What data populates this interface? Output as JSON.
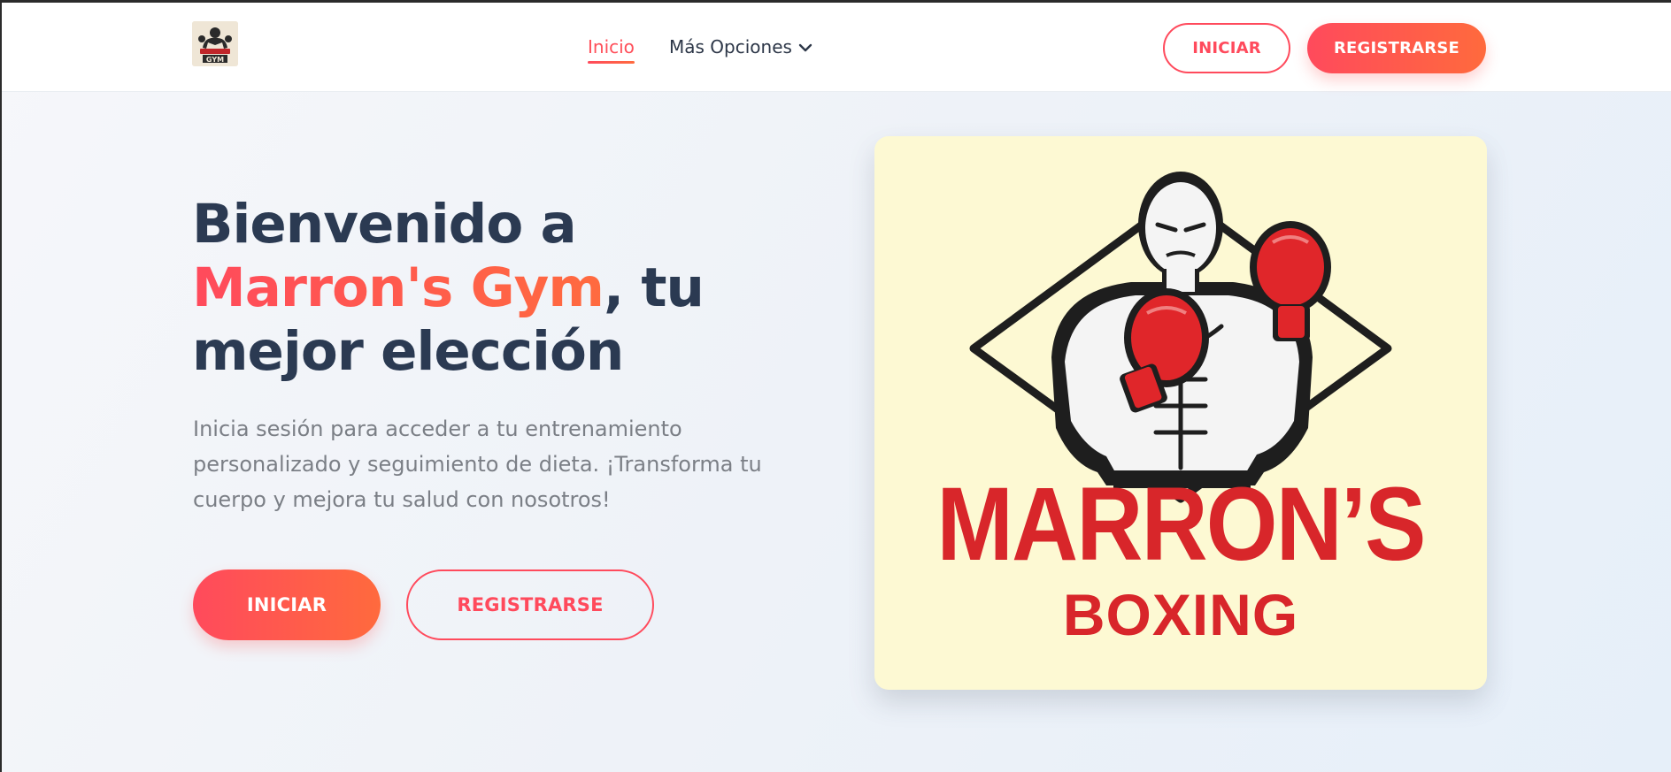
{
  "header": {
    "logo_alt": "Marron's Gym logo",
    "nav": {
      "inicio_label": "Inicio",
      "more_label": "Más Opciones"
    },
    "iniciar_label": "INICIAR",
    "registrarse_label": "REGISTRARSE"
  },
  "hero": {
    "title_part1": "Bienvenido a ",
    "title_brand": "Marron's Gym",
    "title_part2": ", tu mejor elección",
    "description": "Inicia sesión para acceder a tu entrenamiento personalizado y seguimiento de dieta. ¡Transforma tu cuerpo y mejora tu salud con nosotros!",
    "iniciar_label": "INICIAR",
    "registrarse_label": "REGISTRARSE"
  },
  "image_card": {
    "title_line1": "MARRON’S",
    "title_line2": "BOXING"
  },
  "colors": {
    "accent_start": "#ff4a5c",
    "accent_end": "#ff6b3f",
    "heading": "#2b3a52",
    "muted_text": "#7b7f86",
    "card_background": "#fdf9d3",
    "logo_red": "#d8262a"
  },
  "icons": {
    "dropdown": "chevron-down-icon",
    "logo": "gym-logo-icon"
  }
}
